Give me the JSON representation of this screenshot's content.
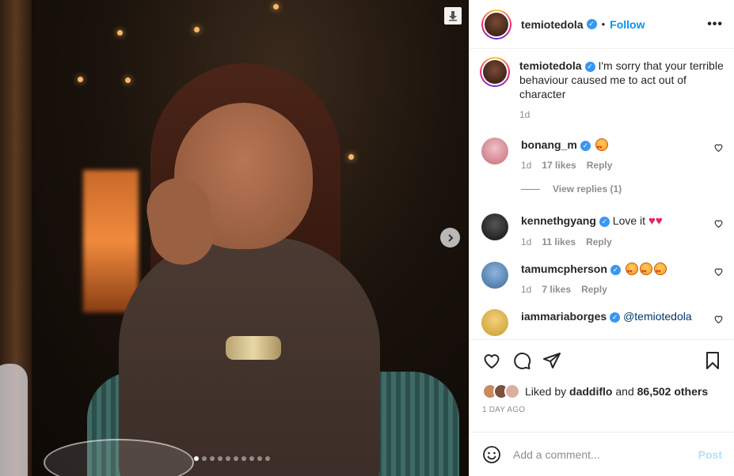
{
  "post": {
    "carousel": {
      "slide_count": 10,
      "active_index": 0
    },
    "author": {
      "username": "temiotedola",
      "verified": true
    },
    "follow_label": "Follow",
    "more_label": "•••",
    "caption": {
      "username": "temiotedola",
      "text": "I'm sorry that your terrible behaviour caused me to act out of character",
      "age": "1d"
    },
    "comments": [
      {
        "username": "bonang_m",
        "verified": true,
        "text": "",
        "age": "1d",
        "likes": "17 likes",
        "reply_label": "Reply",
        "avatar_color": "#d98b9a"
      },
      {
        "username": "kennethgyang",
        "verified": true,
        "text": "Love it",
        "age": "1d",
        "likes": "11 likes",
        "reply_label": "Reply",
        "avatar_color": "#2a2a2a"
      },
      {
        "username": "tamumcpherson",
        "verified": true,
        "text": "",
        "age": "1d",
        "likes": "7 likes",
        "reply_label": "Reply",
        "avatar_color": "#4a78a8"
      },
      {
        "username": "iammariaborges",
        "verified": true,
        "text": "@temiotedola",
        "avatar_color": "#e8b84a"
      }
    ],
    "view_replies": "View replies (1)",
    "liked_by": {
      "prefix": "Liked by",
      "user": "daddiflo",
      "middle": "and",
      "count": "86,502 others"
    },
    "time_ago": "1 DAY AGO",
    "add_comment": {
      "placeholder": "Add a comment...",
      "post_label": "Post"
    }
  },
  "icons": [
    "download-icon",
    "chevron-right-icon",
    "heart-icon",
    "comment-icon",
    "share-icon",
    "bookmark-icon",
    "emoji-icon",
    "verified-icon"
  ],
  "colors": {
    "accent": "#0095f6",
    "verified": "#3897f0",
    "muted": "#8e8e8e",
    "text": "#262626",
    "post_disabled": "#b2dffc"
  }
}
